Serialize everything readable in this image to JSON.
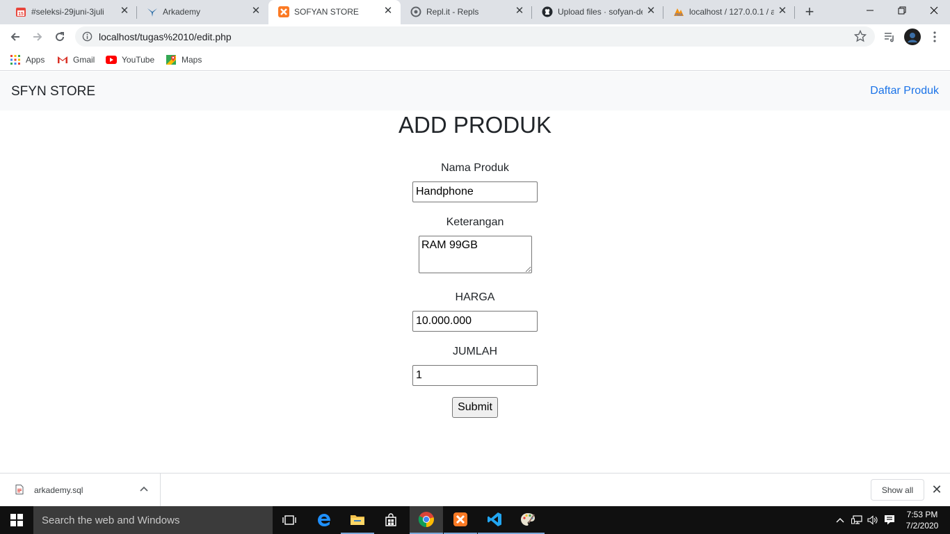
{
  "browser": {
    "tabs": [
      {
        "title": "#seleksi-29juni-3juli",
        "icon": "calendar-icon",
        "active": false
      },
      {
        "title": "Arkademy",
        "icon": "arkademy-icon",
        "active": false
      },
      {
        "title": "SOFYAN STORE",
        "icon": "xampp-icon",
        "active": true
      },
      {
        "title": "Repl.it - Repls",
        "icon": "replit-icon",
        "active": false
      },
      {
        "title": "Upload files · sofyan-de",
        "icon": "github-icon",
        "active": false
      },
      {
        "title": "localhost / 127.0.0.1 / a",
        "icon": "phpmyadmin-icon",
        "active": false
      }
    ],
    "address": "localhost/tugas%2010/edit.php",
    "bookmarks": [
      {
        "label": "Apps",
        "icon": "apps-grid-icon"
      },
      {
        "label": "Gmail",
        "icon": "gmail-icon"
      },
      {
        "label": "YouTube",
        "icon": "youtube-icon"
      },
      {
        "label": "Maps",
        "icon": "maps-icon"
      }
    ]
  },
  "page": {
    "brand": "SFYN STORE",
    "nav_link": "Daftar Produk",
    "heading": "ADD PRODUK",
    "form": {
      "nama_label": "Nama Produk",
      "nama_value": "Handphone",
      "keterangan_label": "Keterangan",
      "keterangan_value": "RAM 99GB",
      "harga_label": "HARGA",
      "harga_value": "10.000.000",
      "jumlah_label": "JUMLAH",
      "jumlah_value": "1",
      "submit_label": "Submit"
    }
  },
  "downloads": {
    "file": "arkademy.sql",
    "show_all": "Show all"
  },
  "taskbar": {
    "search_placeholder": "Search the web and Windows",
    "time": "7:53 PM",
    "date": "7/2/2020"
  },
  "colors": {
    "link": "#1a73e8",
    "navbar_bg": "#f8f9fa",
    "tabstrip_bg": "#dee1e6",
    "taskbar_bg": "#101010"
  }
}
